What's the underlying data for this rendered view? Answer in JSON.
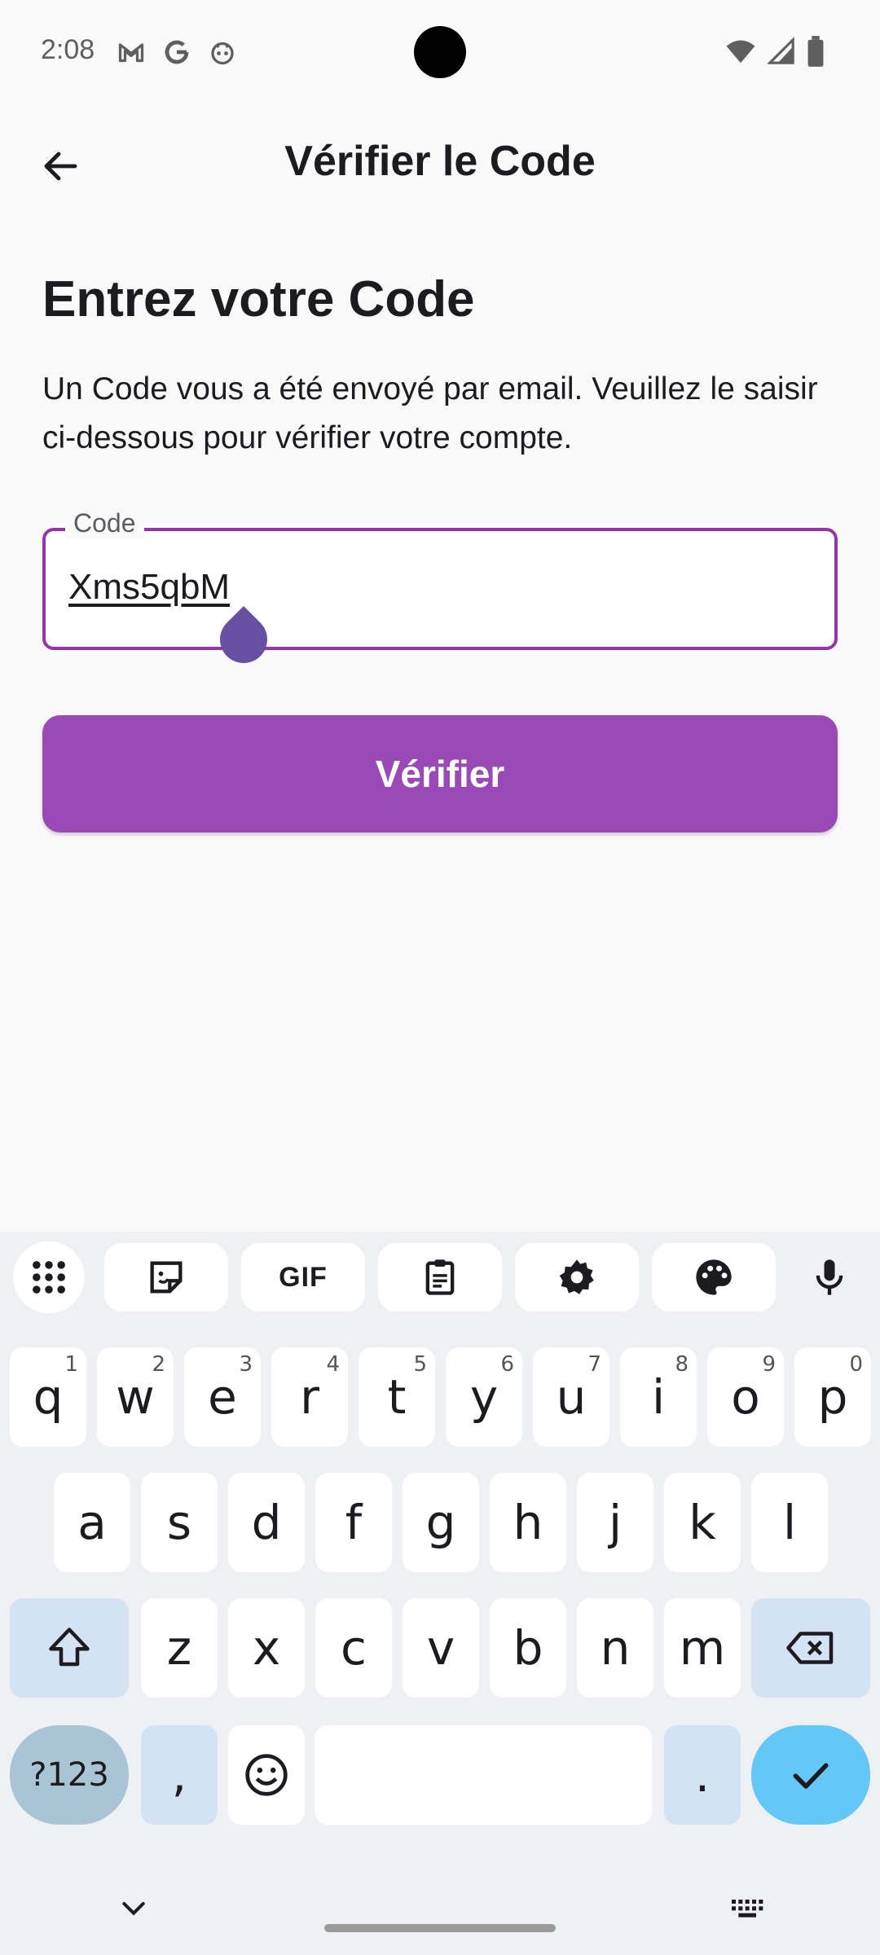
{
  "status_bar": {
    "time": "2:08",
    "left_icons": [
      "gmail-icon",
      "google-icon",
      "robot-icon"
    ],
    "right_icons": [
      "wifi-icon",
      "signal-icon",
      "battery-icon"
    ]
  },
  "app_bar": {
    "title": "Vérifier le Code",
    "back_icon": "arrow-back-icon"
  },
  "main": {
    "heading": "Entrez votre Code",
    "description": "Un Code vous a été envoyé par email. Veuillez le saisir ci-dessous pour vérifier votre compte.",
    "code_field": {
      "label": "Code",
      "value": "Xms5qbM"
    },
    "verify_label": "Vérifier"
  },
  "colors": {
    "accent": "#9a4ab5",
    "field_border": "#9334a9",
    "caret_handle": "#6750a4",
    "keyboard_bg": "#eff0f4",
    "enter_key": "#64c7f5"
  },
  "keyboard": {
    "toolbar": [
      "apps-grid-icon",
      "sticker-icon",
      "GIF",
      "clipboard-icon",
      "settings-icon",
      "palette-icon",
      "mic-icon"
    ],
    "row1": [
      {
        "k": "q",
        "h": "1"
      },
      {
        "k": "w",
        "h": "2"
      },
      {
        "k": "e",
        "h": "3"
      },
      {
        "k": "r",
        "h": "4"
      },
      {
        "k": "t",
        "h": "5"
      },
      {
        "k": "y",
        "h": "6"
      },
      {
        "k": "u",
        "h": "7"
      },
      {
        "k": "i",
        "h": "8"
      },
      {
        "k": "o",
        "h": "9"
      },
      {
        "k": "p",
        "h": "0"
      }
    ],
    "row2": [
      "a",
      "s",
      "d",
      "f",
      "g",
      "h",
      "j",
      "k",
      "l"
    ],
    "row3": [
      "z",
      "x",
      "c",
      "v",
      "b",
      "n",
      "m"
    ],
    "symbols_label": "?123",
    "comma": ",",
    "period": "."
  }
}
